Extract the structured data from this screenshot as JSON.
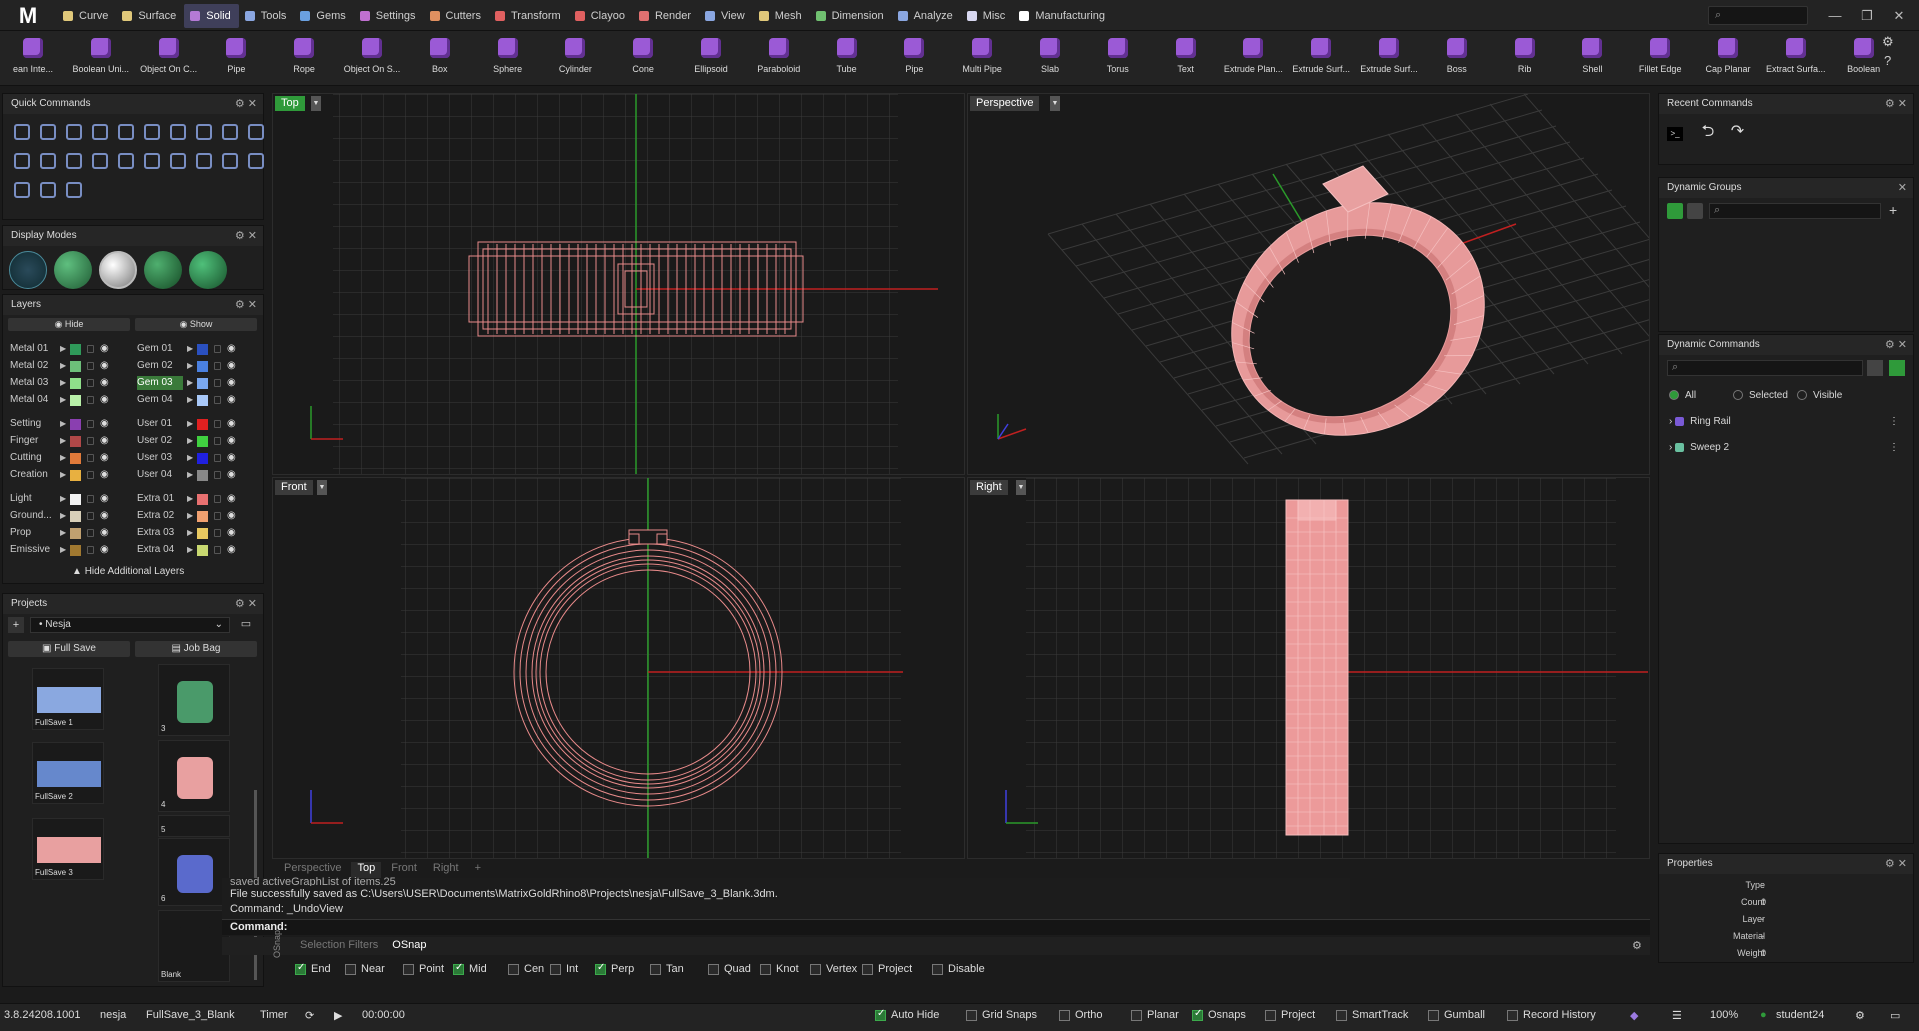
{
  "app": {
    "logo": "M"
  },
  "tabs": [
    {
      "label": "Curve",
      "color": "#e0c87a"
    },
    {
      "label": "Surface",
      "color": "#e0c87a"
    },
    {
      "label": "Solid",
      "color": "#b57ad6"
    },
    {
      "label": "Tools",
      "color": "#8aa6e0"
    },
    {
      "label": "Gems",
      "color": "#6aa0e0"
    },
    {
      "label": "Settings",
      "color": "#c070d0"
    },
    {
      "label": "Cutters",
      "color": "#e09060"
    },
    {
      "label": "Transform",
      "color": "#e06060"
    },
    {
      "label": "Clayoo",
      "color": "#e06060"
    },
    {
      "label": "Render",
      "color": "#e07070"
    },
    {
      "label": "View",
      "color": "#8aa6e0"
    },
    {
      "label": "Mesh",
      "color": "#e0c87a"
    },
    {
      "label": "Dimension",
      "color": "#70c070"
    },
    {
      "label": "Analyze",
      "color": "#8aa6e0"
    },
    {
      "label": "Misc",
      "color": "#d8d8f0"
    },
    {
      "label": "Manufacturing",
      "color": "#ffffff"
    }
  ],
  "ribbon": [
    "ean Inte...",
    "Boolean Uni...",
    "Object On C...",
    "Pipe",
    "Rope",
    "Object On S...",
    "Box",
    "Sphere",
    "Cylinder",
    "Cone",
    "Ellipsoid",
    "Paraboloid",
    "Tube",
    "Pipe",
    "Multi Pipe",
    "Slab",
    "Torus",
    "Text",
    "Extrude Plan...",
    "Extrude Surf...",
    "Extrude Surf...",
    "Boss",
    "Rib",
    "Shell",
    "Fillet Edge",
    "Cap Planar",
    "Extract Surfa...",
    "Boolean"
  ],
  "panels": {
    "quick": "Quick Commands",
    "display": "Display Modes",
    "layers": "Layers",
    "projects": "Projects",
    "recent": "Recent Commands",
    "groups": "Dynamic Groups",
    "dyncmd": "Dynamic Commands",
    "props": "Properties"
  },
  "layers": {
    "hide": "Hide",
    "show": "Show",
    "more": "Hide Additional Layers",
    "left": [
      {
        "name": "Metal 01",
        "color": "#2f9a5a"
      },
      {
        "name": "Metal 02",
        "color": "#6dbf7a"
      },
      {
        "name": "Metal 03",
        "color": "#8fe08a"
      },
      {
        "name": "Metal 04",
        "color": "#b8f0a8"
      },
      {
        "name": "Setting",
        "color": "#8a3fb0"
      },
      {
        "name": "Finger",
        "color": "#b04848"
      },
      {
        "name": "Cutting",
        "color": "#e07a3a"
      },
      {
        "name": "Creation",
        "color": "#e8b040"
      },
      {
        "name": "Light",
        "color": "#f2f2f2"
      },
      {
        "name": "Ground...",
        "color": "#d8cfb8"
      },
      {
        "name": "Prop",
        "color": "#c0a070"
      },
      {
        "name": "Emissive",
        "color": "#a07830"
      }
    ],
    "right": [
      {
        "name": "Gem 01",
        "color": "#2a50c0"
      },
      {
        "name": "Gem 02",
        "color": "#4a80e0"
      },
      {
        "name": "Gem 03",
        "color": "#7aa8f0"
      },
      {
        "name": "Gem 04",
        "color": "#a8c8f8"
      },
      {
        "name": "User 01",
        "color": "#e02020"
      },
      {
        "name": "User 02",
        "color": "#40d040"
      },
      {
        "name": "User 03",
        "color": "#2020e0"
      },
      {
        "name": "User 04",
        "color": "#888888"
      },
      {
        "name": "Extra 01",
        "color": "#e87070"
      },
      {
        "name": "Extra 02",
        "color": "#f0a070"
      },
      {
        "name": "Extra 03",
        "color": "#e8c860"
      },
      {
        "name": "Extra 04",
        "color": "#c8d870"
      }
    ]
  },
  "projects": {
    "selected": "Nesja",
    "full_save": "Full Save",
    "job_bag": "Job Bag",
    "thumbs_left": [
      "FullSave 1",
      "FullSave 2",
      "FullSave 3"
    ],
    "thumbs_right": [
      "3",
      "4",
      "5",
      "6",
      "Blank"
    ]
  },
  "viewports": {
    "top": "Top",
    "perspective": "Perspective",
    "front": "Front",
    "right": "Right"
  },
  "view_tabs": [
    "Perspective",
    "Top",
    "Front",
    "Right",
    "+"
  ],
  "command": {
    "line1": "saved activeGraphList of items.25",
    "line2": "File successfully saved as C:\\Users\\USER\\Documents\\MatrixGoldRhino8\\Projects\\nesja\\FullSave_3_Blank.3dm.",
    "line3": "Command: _UndoView",
    "prompt": "Command:"
  },
  "snap_tabs": [
    "Selection Filters",
    "OSnap"
  ],
  "osnap_side": "OSnap",
  "osnap": [
    {
      "label": "End",
      "on": true
    },
    {
      "label": "Near",
      "on": false
    },
    {
      "label": "Point",
      "on": false
    },
    {
      "label": "Mid",
      "on": true
    },
    {
      "label": "Cen",
      "on": false
    },
    {
      "label": "Int",
      "on": false
    },
    {
      "label": "Perp",
      "on": true
    },
    {
      "label": "Tan",
      "on": false
    },
    {
      "label": "Quad",
      "on": false
    },
    {
      "label": "Knot",
      "on": false
    },
    {
      "label": "Vertex",
      "on": false
    },
    {
      "label": "Project",
      "on": false
    },
    {
      "label": "Disable",
      "on": false
    }
  ],
  "dyncmd": {
    "filters": [
      "All",
      "Selected",
      "Visible"
    ],
    "items": [
      {
        "label": "Ring Rail",
        "color": "#7a5ad6"
      },
      {
        "label": "Sweep 2",
        "color": "#6ac0a0"
      }
    ]
  },
  "properties": [
    {
      "k": "Type",
      "v": "-"
    },
    {
      "k": "Count",
      "v": "0"
    },
    {
      "k": "Layer",
      "v": "-"
    },
    {
      "k": "Material",
      "v": "-"
    },
    {
      "k": "Weight",
      "v": "0"
    }
  ],
  "status": {
    "version": "3.8.24208.1001",
    "project": "nesja",
    "file": "FullSave_3_Blank",
    "timer": "Timer",
    "time": "00:00:00",
    "toggles": [
      {
        "label": "Auto Hide",
        "on": true
      },
      {
        "label": "Grid Snaps",
        "on": false
      },
      {
        "label": "Ortho",
        "on": false
      },
      {
        "label": "Planar",
        "on": false
      },
      {
        "label": "Osnaps",
        "on": true
      },
      {
        "label": "Project",
        "on": false
      },
      {
        "label": "SmartTrack",
        "on": false
      },
      {
        "label": "Gumball",
        "on": false
      },
      {
        "label": "Record History",
        "on": false
      }
    ],
    "zoom": "100%",
    "user": "student24"
  }
}
